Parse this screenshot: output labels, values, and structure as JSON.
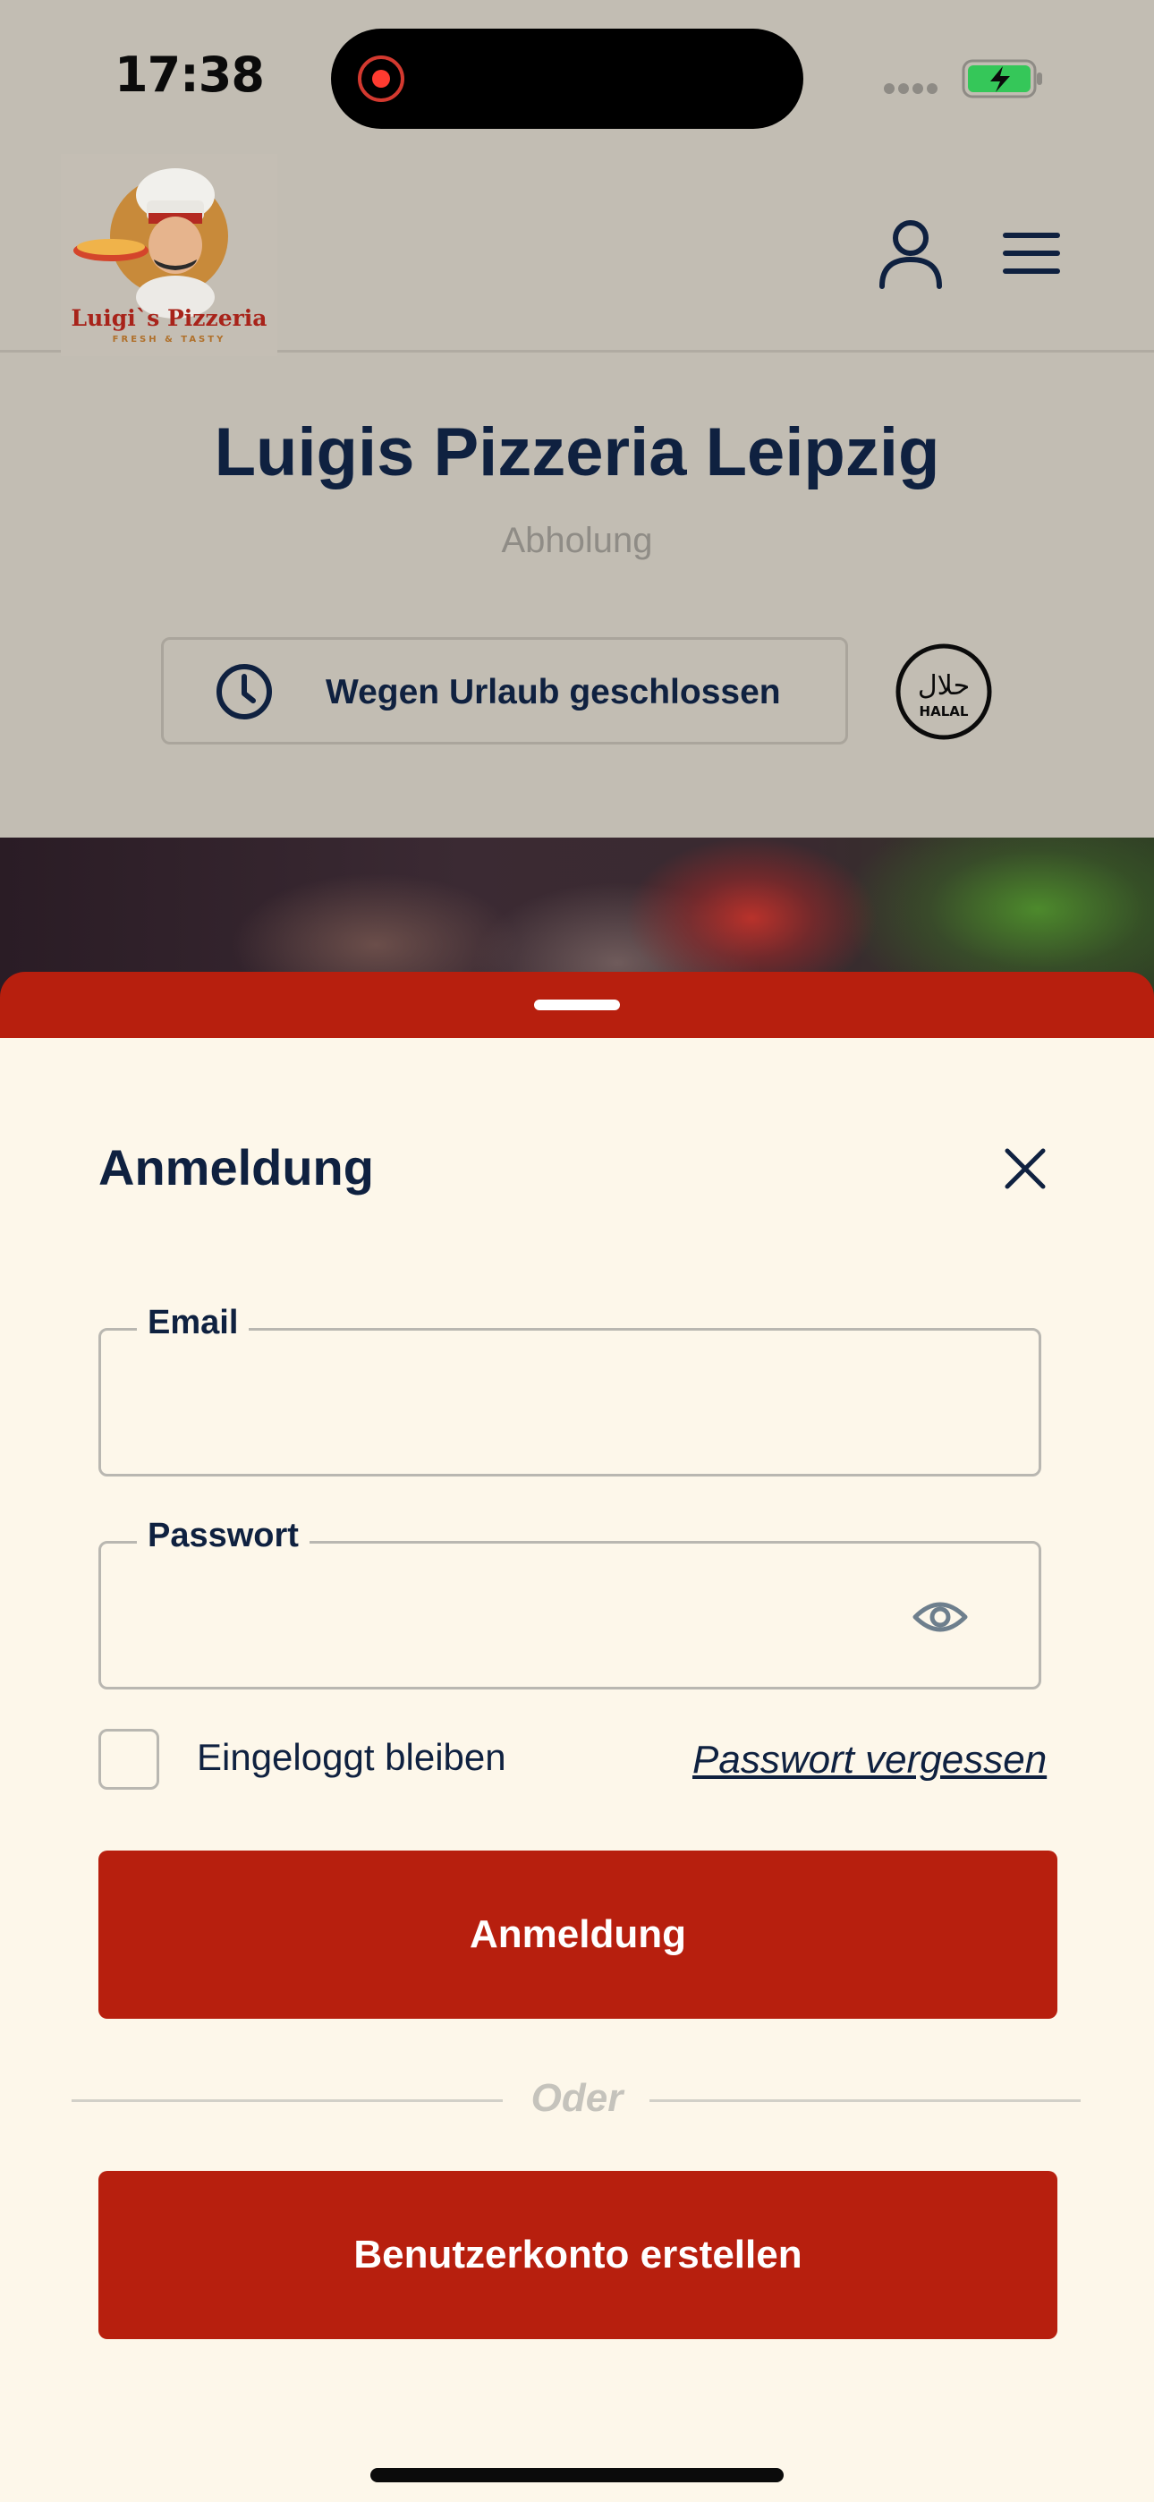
{
  "status_bar": {
    "time": "17:38"
  },
  "header": {
    "logo_text": "Luigi`s Pizzeria",
    "logo_tagline": "FRESH & TASTY"
  },
  "store": {
    "name": "Luigis Pizzeria Leipzig",
    "mode": "Abholung",
    "status_text": "Wegen Urlaub geschlossen",
    "halal_label": "HALAL",
    "halal_arabic": "حلال"
  },
  "login_sheet": {
    "title": "Anmeldung",
    "email": {
      "label": "Email",
      "value": ""
    },
    "password": {
      "label": "Passwort",
      "value": ""
    },
    "remember_label": "Eingeloggt bleiben",
    "remember_checked": false,
    "forgot_password": "Passwort vergessen",
    "login_button": "Anmeldung",
    "divider": "Oder",
    "register_button": "Benutzerkonto erstellen"
  },
  "colors": {
    "accent_red": "#b71f0e",
    "navy": "#0f2140",
    "sheet_bg": "#fdf7ea",
    "dim_bg": "#c2bdb3"
  },
  "icons": [
    "record-icon",
    "battery-icon",
    "account-icon",
    "menu-icon",
    "clock-icon",
    "halal-icon",
    "close-icon",
    "eye-icon"
  ]
}
